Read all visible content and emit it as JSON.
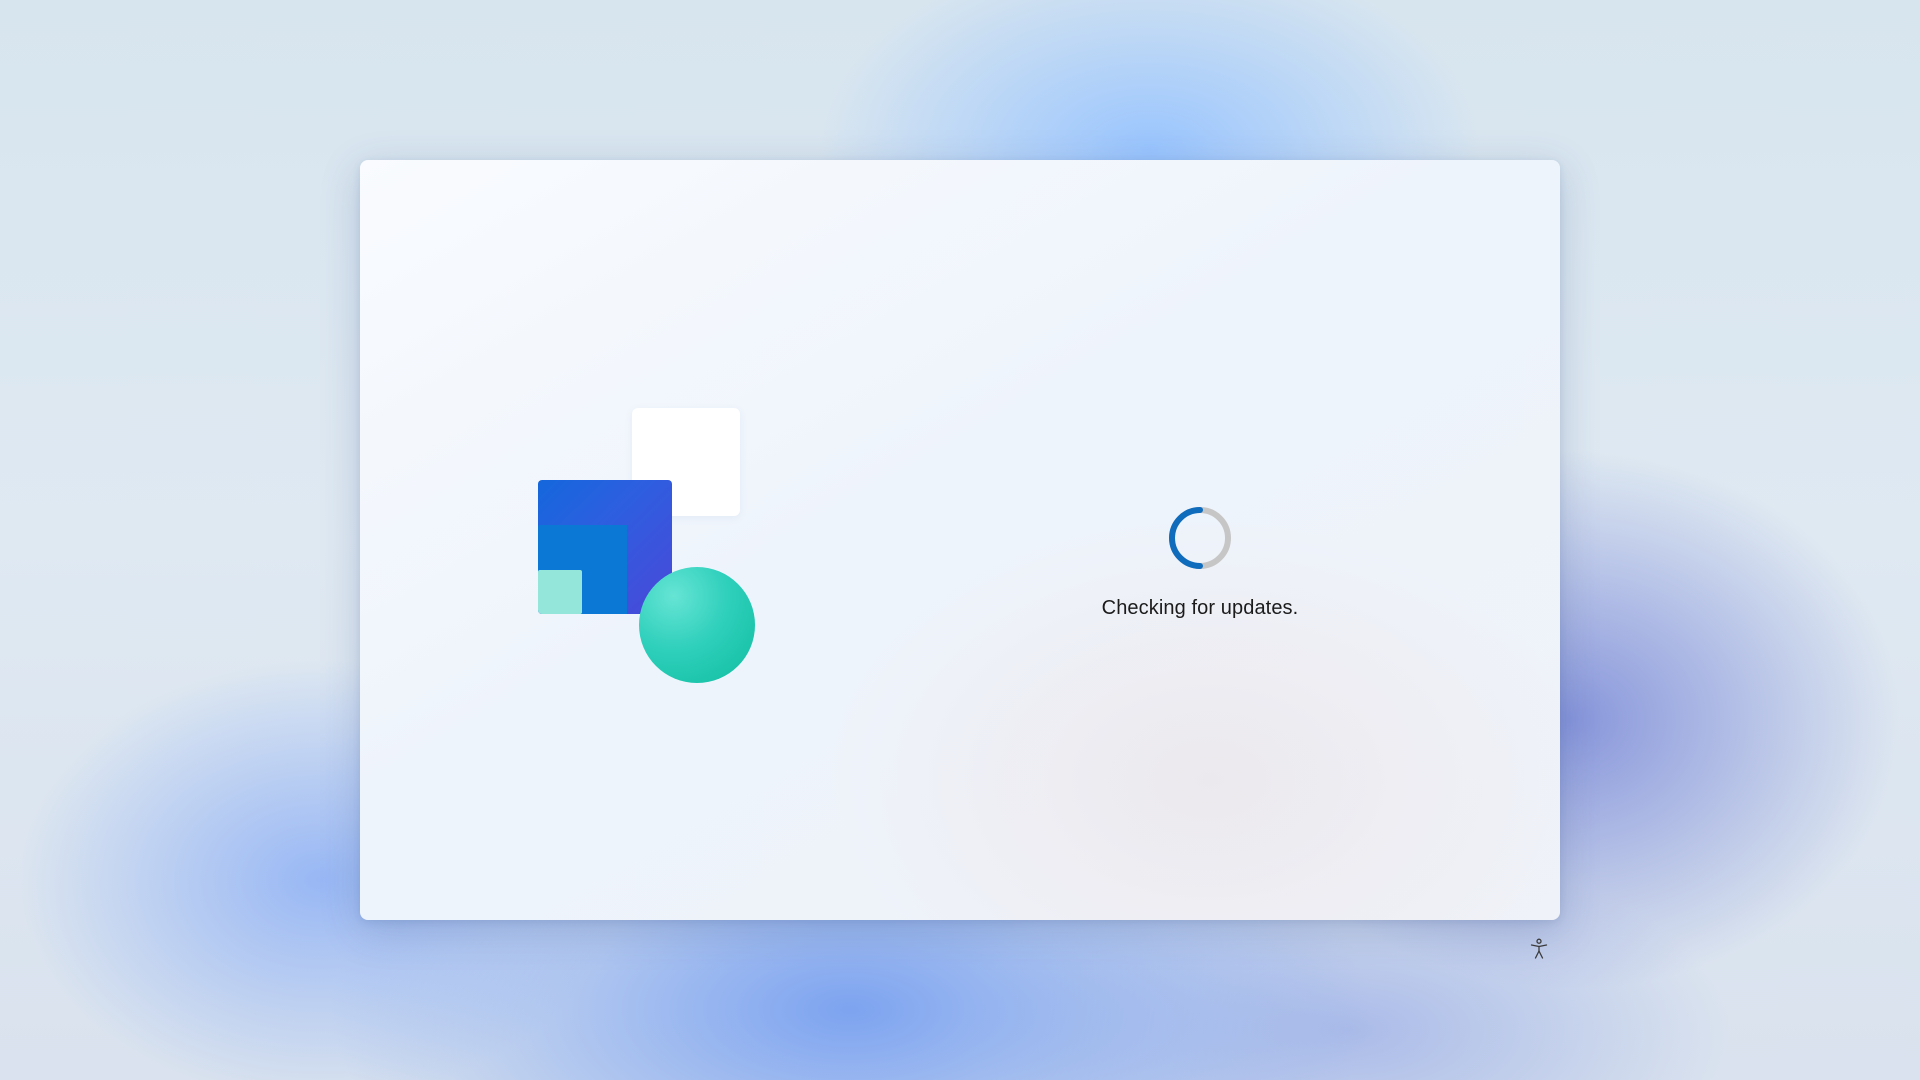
{
  "status": {
    "message": "Checking for updates.",
    "progress_icon": "loading-spinner-icon"
  },
  "illustration": {
    "icon": "windows-setup-logo",
    "colors": {
      "white_square": "#ffffff",
      "purple_square": "#3d52dc",
      "blue_square": "#0a78d4",
      "mint_square": "#95e6da",
      "teal_circle": "#1cc8b0"
    }
  },
  "footer": {
    "accessibility_icon": "accessibility-icon"
  },
  "colors": {
    "accent": "#0f6cbd",
    "spinner_track": "#c6c6c6"
  }
}
